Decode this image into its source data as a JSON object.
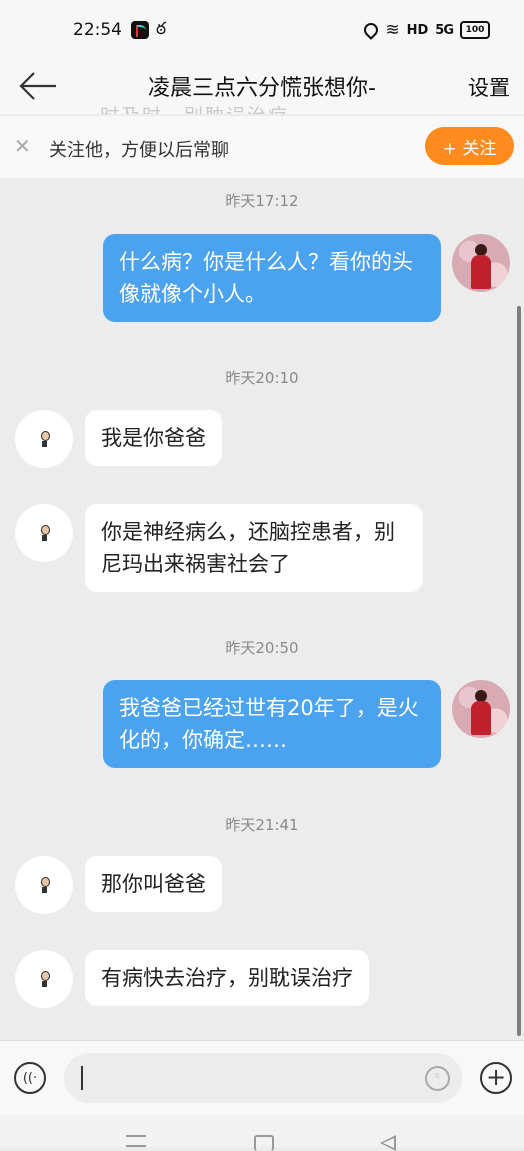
{
  "status_bar": {
    "time": "22:54",
    "hd": "HD",
    "signal": "5G",
    "battery": "100"
  },
  "header": {
    "title": "凌晨三点六分慌张想你-",
    "settings": "设置",
    "ghost_text": "时及时，别耽误治疗"
  },
  "follow_bar": {
    "text": "关注他，方便以后常聊",
    "button": "+ 关注"
  },
  "messages": [
    {
      "timestamp": "昨天17:12"
    },
    {
      "from": "me",
      "text": "什么病？你是什么人？看你的头像就像个小人。"
    },
    {
      "timestamp": "昨天20:10"
    },
    {
      "from": "other",
      "text": "我是你爸爸"
    },
    {
      "from": "other",
      "text": "你是神经病么，还脑控患者，别尼玛出来祸害社会了"
    },
    {
      "timestamp": "昨天20:50"
    },
    {
      "from": "me",
      "text": "我爸爸已经过世有20年了，是火化的，你确定……"
    },
    {
      "timestamp": "昨天21:41"
    },
    {
      "from": "other",
      "text": "那你叫爸爸"
    },
    {
      "from": "other",
      "text": "有病快去治疗，别耽误治疗"
    }
  ],
  "colors": {
    "sent_bubble": "#4ba3f0",
    "follow_button": "#ff8a1d"
  },
  "icons": [
    "back-arrow-icon",
    "close-icon",
    "voice-icon",
    "emoji-icon",
    "plus-icon"
  ]
}
